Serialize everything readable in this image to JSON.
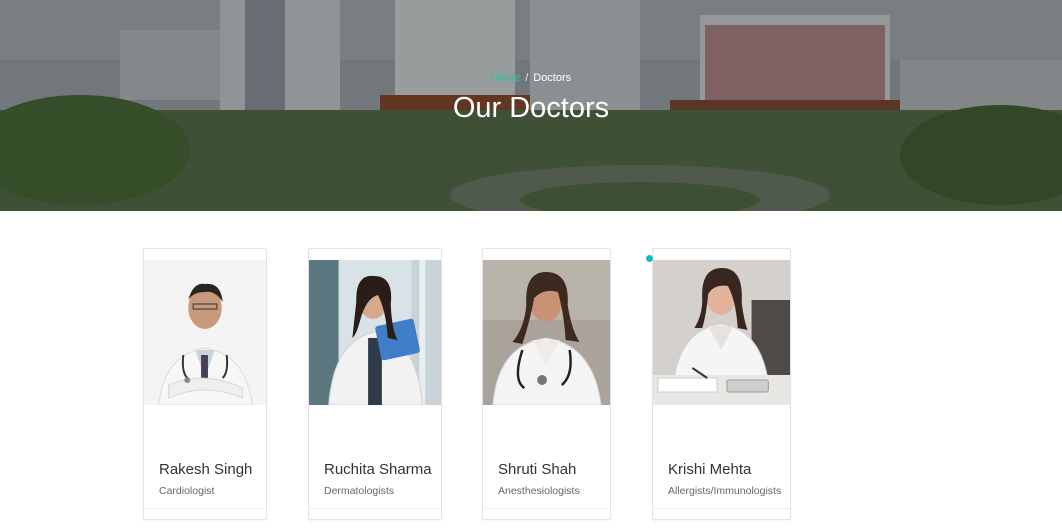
{
  "hero": {
    "breadcrumb": {
      "home": "Home",
      "separator": "/",
      "current": "Doctors"
    },
    "title": "Our Doctors"
  },
  "doctors": [
    {
      "name": "Rakesh Singh",
      "specialty": "Cardiologist"
    },
    {
      "name": "Ruchita Sharma",
      "specialty": "Dermatologists"
    },
    {
      "name": "Shruti Shah",
      "specialty": "Anesthesiologists"
    },
    {
      "name": "Krishi Mehta",
      "specialty": "Allergists/Immunologists"
    }
  ],
  "colors": {
    "accent": "#20c997",
    "cursor": "#17b6c9"
  }
}
